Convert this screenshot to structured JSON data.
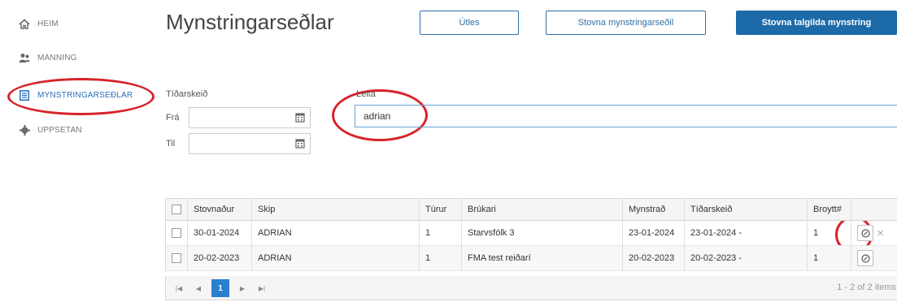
{
  "sidebar": {
    "items": [
      {
        "label": "HEIM",
        "icon": "home-icon"
      },
      {
        "label": "MANNING",
        "icon": "people-icon"
      },
      {
        "label": "MYNSTRINGARSEÐLAR",
        "icon": "document-icon"
      },
      {
        "label": "UPPSETAN",
        "icon": "gear-icon"
      }
    ]
  },
  "header": {
    "title": "Mynstringarseðlar",
    "buttons": {
      "utles": "Útles",
      "create": "Stovna mynstringarseðil",
      "create_valid": "Stovna talgilda mynstring"
    }
  },
  "filters": {
    "period_label": "Tíðarskeið",
    "from_label": "Frá",
    "to_label": "Til",
    "from_value": "",
    "to_value": "",
    "search_label": "Leita",
    "search_value": "adrian"
  },
  "table": {
    "columns": [
      "Stovnaður",
      "Skip",
      "Túrur",
      "Brúkari",
      "Mynstrað",
      "Tíðarskeið",
      "Broytt#"
    ],
    "rows": [
      {
        "created": "30-01-2024",
        "ship": "ADRIAN",
        "trip": "1",
        "user": "Starvsfólk 3",
        "mustered": "23-01-2024",
        "period": "23-01-2024 -",
        "changed": "1"
      },
      {
        "created": "20-02-2023",
        "ship": "ADRIAN",
        "trip": "1",
        "user": "FMA test reiðarí",
        "mustered": "20-02-2023",
        "period": "20-02-2023 -",
        "changed": "1"
      }
    ]
  },
  "pager": {
    "current_page": "1",
    "info": "1 - 2 of 2 items"
  },
  "colors": {
    "accent": "#1d6aa8",
    "highlight": "#d8232a"
  }
}
